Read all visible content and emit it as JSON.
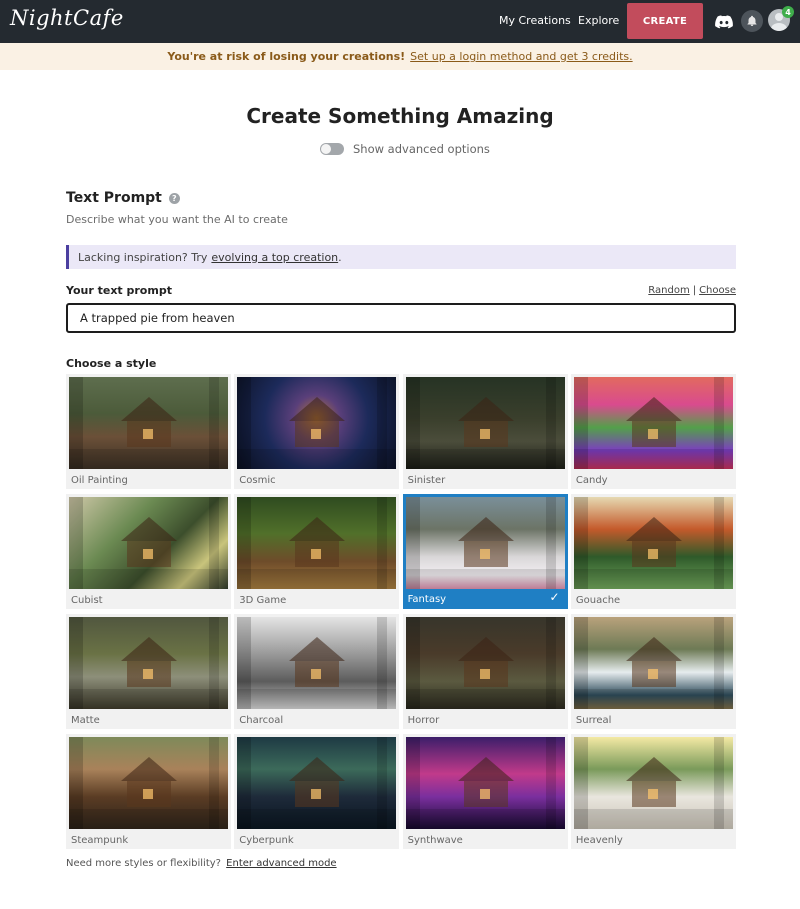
{
  "nav": {
    "logo": "NightCafe",
    "my_creations": "My Creations",
    "explore": "Explore",
    "create": "CREATE",
    "notification_count": "4"
  },
  "banner": {
    "warning": "You're at risk of losing your creations!",
    "link": "Set up a login method and get 3 credits."
  },
  "header": {
    "title": "Create Something Amazing",
    "advanced_toggle_label": "Show advanced options",
    "advanced_enabled": false
  },
  "text_prompt": {
    "title": "Text Prompt",
    "help_icon": "?",
    "description": "Describe what you want the AI to create",
    "inspiration_prefix": "Lacking inspiration? Try",
    "inspiration_link": "evolving a top creation",
    "inspiration_suffix": ".",
    "input_label": "Your text prompt",
    "random_link": "Random",
    "separator": "|",
    "choose_link": "Choose",
    "input_value": "A trapped pie from heaven"
  },
  "styles": {
    "label": "Choose a style",
    "selected": "Fantasy",
    "items": [
      {
        "name": "Oil Painting",
        "thumb": "t-oil"
      },
      {
        "name": "Cosmic",
        "thumb": "t-cosmic"
      },
      {
        "name": "Sinister",
        "thumb": "t-sinister"
      },
      {
        "name": "Candy",
        "thumb": "t-candy"
      },
      {
        "name": "Cubist",
        "thumb": "t-cubist"
      },
      {
        "name": "3D Game",
        "thumb": "t-3d"
      },
      {
        "name": "Fantasy",
        "thumb": "t-fantasy"
      },
      {
        "name": "Gouache",
        "thumb": "t-gouache"
      },
      {
        "name": "Matte",
        "thumb": "t-matte"
      },
      {
        "name": "Charcoal",
        "thumb": "t-charcoal"
      },
      {
        "name": "Horror",
        "thumb": "t-horror"
      },
      {
        "name": "Surreal",
        "thumb": "t-surreal"
      },
      {
        "name": "Steampunk",
        "thumb": "t-steampunk"
      },
      {
        "name": "Cyberpunk",
        "thumb": "t-cyberpunk"
      },
      {
        "name": "Synthwave",
        "thumb": "t-synthwave"
      },
      {
        "name": "Heavenly",
        "thumb": "t-heavenly"
      }
    ]
  },
  "footer": {
    "prefix": "Need more styles or flexibility?",
    "link": "Enter advanced mode"
  },
  "colors": {
    "nav_bg": "#242a30",
    "create_button": "#c24c5c",
    "banner_bg": "#faf1e4",
    "banner_text": "#8a5a19",
    "inspire_bg": "#ebe8f7",
    "inspire_border": "#4b3fa0",
    "selected_accent": "#1f7fc4",
    "badge": "#3fae4b"
  },
  "icons": {
    "discord": "discord-icon",
    "bell": "bell-icon",
    "avatar": "avatar-icon",
    "help": "help-icon",
    "check": "check-icon"
  }
}
